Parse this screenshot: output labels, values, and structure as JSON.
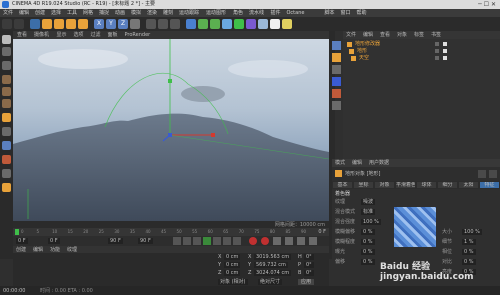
{
  "window": {
    "title": "CINEMA 4D R19.024 Studio (RC - R19) - [未标题 2 *] - 主要",
    "controls": "─ ☐ ✕"
  },
  "menubar": [
    "文件",
    "编辑",
    "创建",
    "选择",
    "工具",
    "网格",
    "捕捉",
    "动画",
    "模拟",
    "渲染",
    "雕刻",
    "运动跟踪",
    "运动图形",
    "角色",
    "流水线",
    "插件",
    "Octane",
    "脚本",
    "窗口",
    "帮助"
  ],
  "viewport": {
    "menu": [
      "查看",
      "摄像机",
      "显示",
      "选项",
      "过滤",
      "面板",
      "ProRender"
    ],
    "status": "网格间距：10000 cm"
  },
  "timeline": {
    "ticks": [
      "0",
      "5",
      "10",
      "15",
      "20",
      "25",
      "30",
      "35",
      "40",
      "45",
      "50",
      "55",
      "60",
      "65",
      "70",
      "75",
      "80",
      "85",
      "90"
    ],
    "end": "0 F"
  },
  "playback": {
    "start": "0 F",
    "current": "0 F",
    "end_a": "90 F",
    "end_b": "90 F"
  },
  "material_bar": {
    "items": [
      "创建",
      "编辑",
      "功能",
      "纹理"
    ]
  },
  "coords": {
    "rows": [
      {
        "axis": "X",
        "pos": "0 cm",
        "size_axis": "X",
        "size": "3019.563 cm",
        "rot_axis": "H",
        "rot": "0°"
      },
      {
        "axis": "Y",
        "pos": "0 cm",
        "size_axis": "Y",
        "size": "569.732 cm",
        "rot_axis": "P",
        "rot": "0°"
      },
      {
        "axis": "Z",
        "pos": "0 cm",
        "size_axis": "Z",
        "size": "3024.074 cm",
        "rot_axis": "B",
        "rot": "0°"
      }
    ],
    "mode_a": "对象 (相对)",
    "mode_b": "绝对尺寸",
    "apply": "应用"
  },
  "statusbar": {
    "left": "00:00:00",
    "hint": "时间 : 0.00  ETA : 0.00"
  },
  "objects": {
    "tabs": [
      "文件",
      "编辑",
      "查看",
      "对象",
      "标签",
      "书签"
    ],
    "items": [
      {
        "name": "地形修改器",
        "color": "#e8a23a"
      },
      {
        "name": "地形",
        "color": "#e8a23a"
      },
      {
        "name": "天空",
        "color": "#e8a23a"
      }
    ]
  },
  "attributes": {
    "tabs": [
      "模式",
      "编辑",
      "用户数据"
    ],
    "header": "地形对象 [地形]",
    "sub_tabs": [
      "基本",
      "坐标",
      "对象",
      "平滑着色(Phong)",
      "球体",
      "细分",
      "太阳",
      "特征"
    ],
    "section": "着色器",
    "fields": [
      {
        "label": "纹理",
        "value": "噪波"
      },
      {
        "label": "混合模式",
        "value": "标准"
      },
      {
        "label": "混合强度",
        "value": "100 %"
      },
      {
        "label": "模糊偏移",
        "value": "0 %"
      },
      {
        "label": "模糊程度",
        "value": "0 %"
      },
      {
        "label": "曝光",
        "value": "0 %"
      },
      {
        "label": "偏移",
        "value": "0 %"
      }
    ],
    "right_fields": [
      {
        "label": "大小",
        "value": "100 %"
      },
      {
        "label": "细节",
        "value": "1 %"
      },
      {
        "label": "相位",
        "value": "0 %"
      },
      {
        "label": "对比",
        "value": "0 %"
      },
      {
        "label": "亮度",
        "value": "0 %"
      }
    ]
  },
  "watermark": "Baidu 经验\njingyan.baidu.com",
  "colors": {
    "accent": "#e8a23a",
    "selection": "#3c6ea8",
    "axis_x": "#d23a2f",
    "axis_y": "#3fbf4a",
    "axis_z": "#3a5bd2"
  }
}
